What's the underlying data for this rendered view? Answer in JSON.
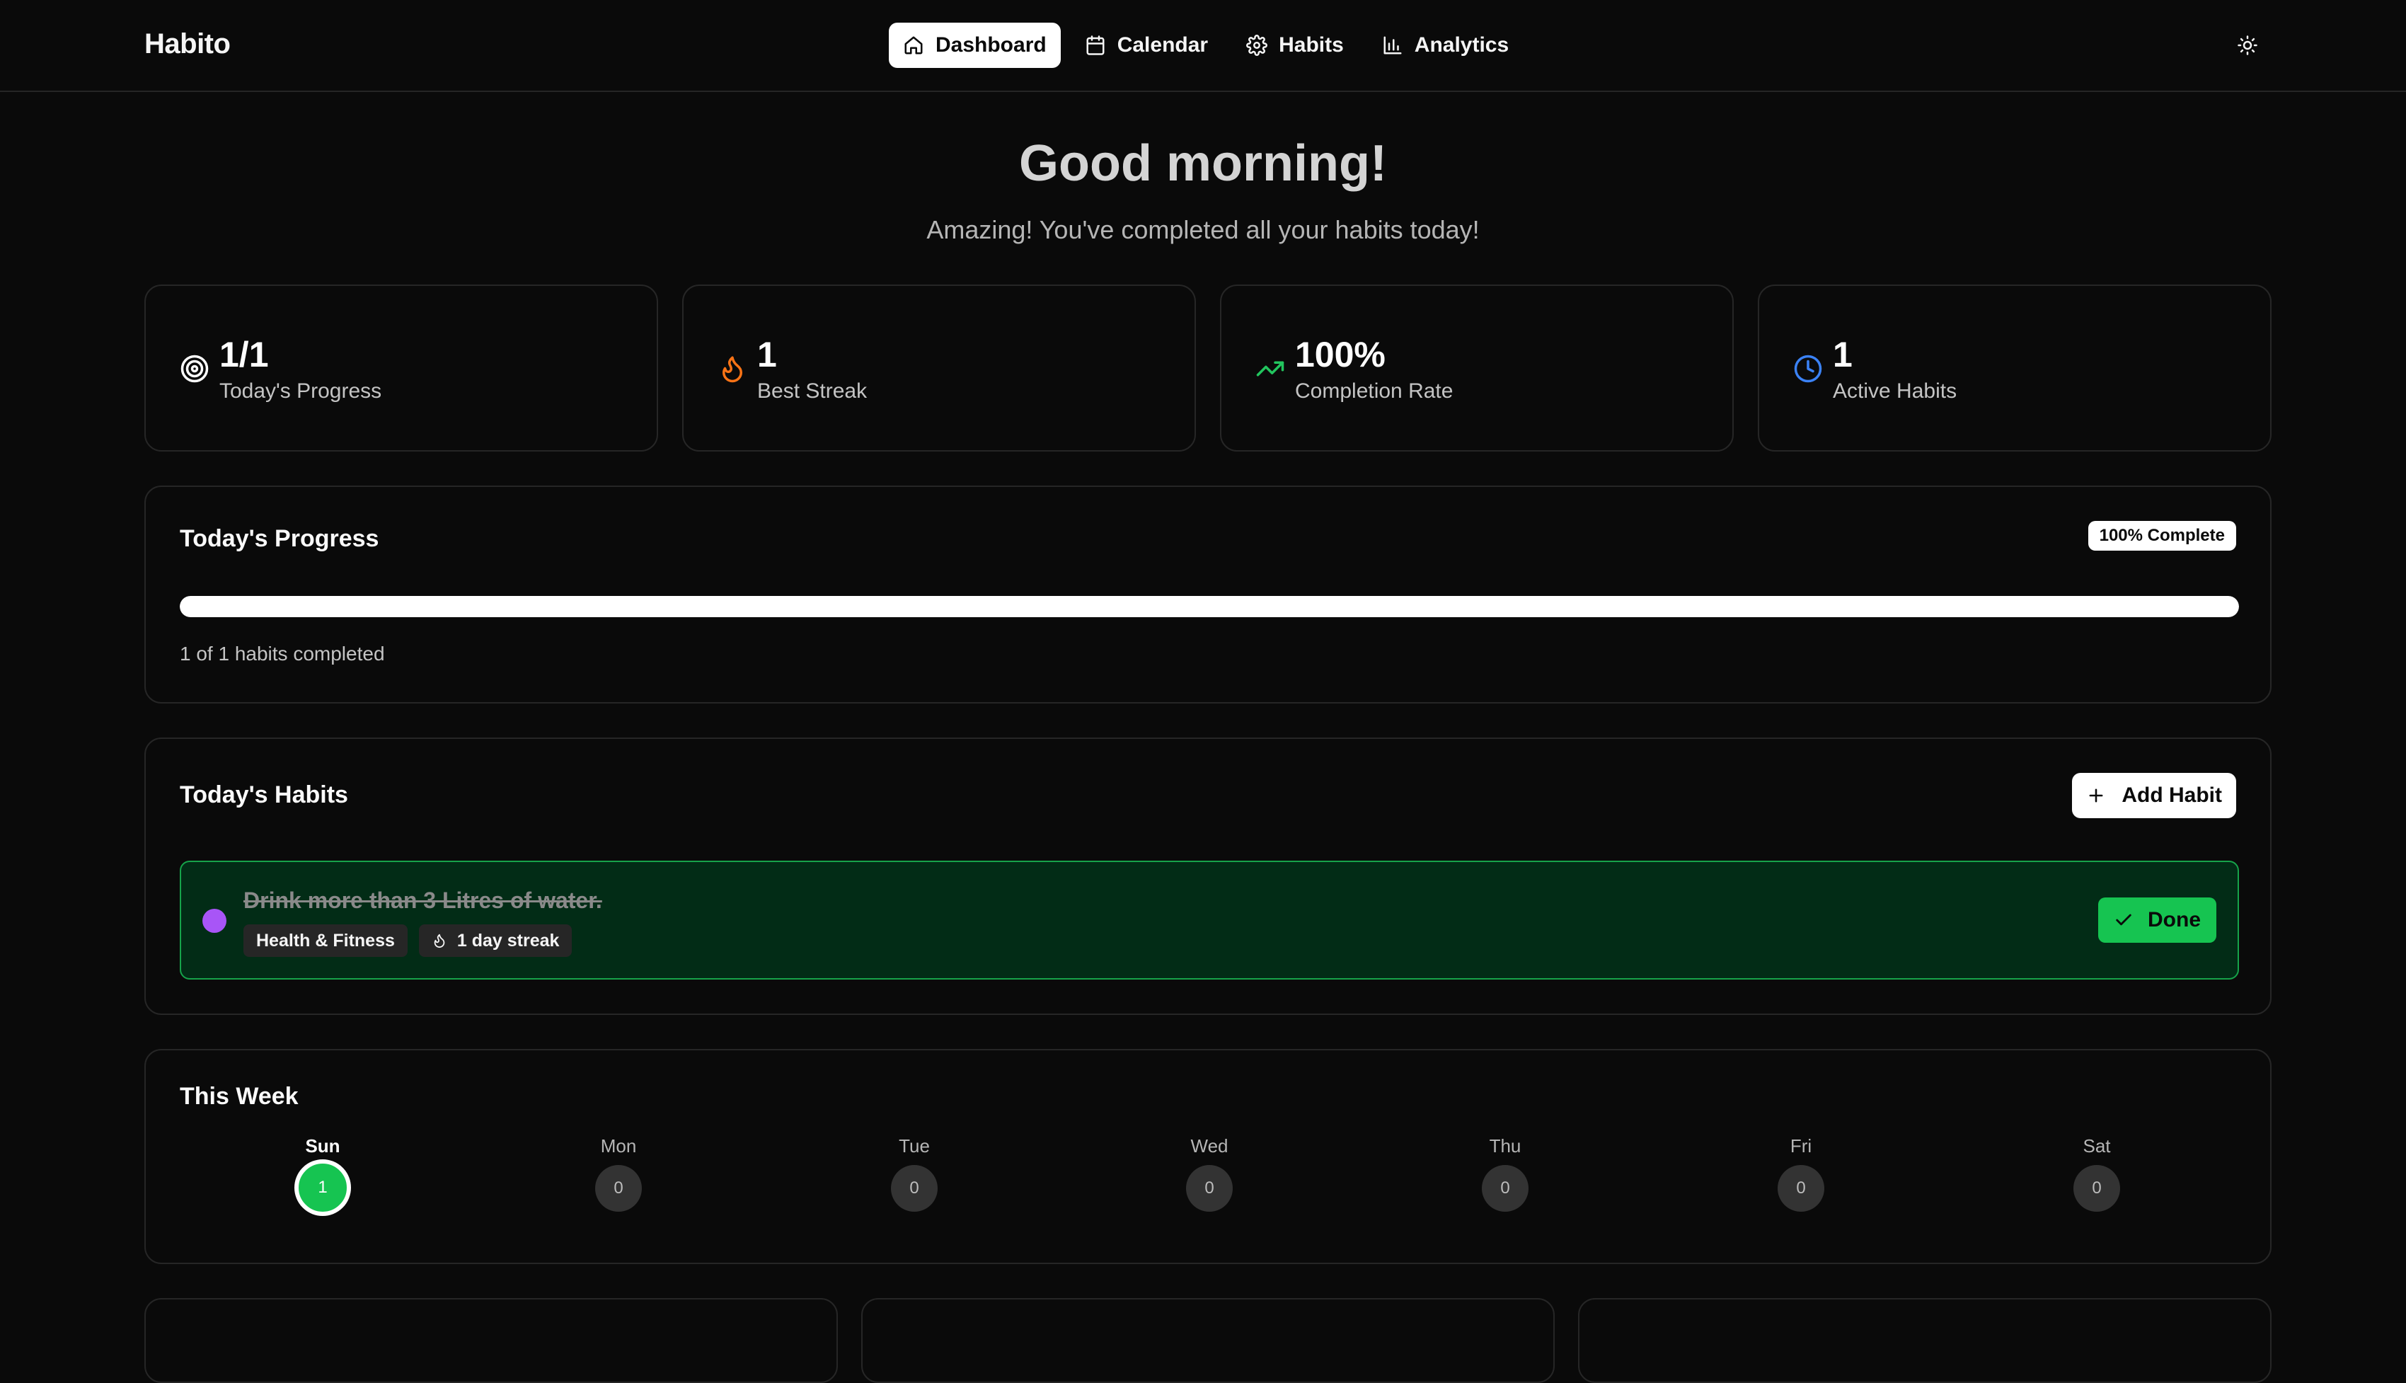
{
  "app": {
    "title": "Habito"
  },
  "nav": {
    "items": [
      {
        "label": "Dashboard",
        "icon": "home-icon",
        "active": true
      },
      {
        "label": "Calendar",
        "icon": "calendar-icon",
        "active": false
      },
      {
        "label": "Habits",
        "icon": "gear-icon",
        "active": false
      },
      {
        "label": "Analytics",
        "icon": "bar-chart-icon",
        "active": false
      }
    ],
    "theme_toggle_icon": "sun-icon"
  },
  "greeting": {
    "title": "Good morning!",
    "subtitle": "Amazing! You've completed all your habits today!"
  },
  "stats": [
    {
      "value": "1/1",
      "label": "Today's Progress",
      "icon": "target-icon",
      "color": "#ffffff"
    },
    {
      "value": "1",
      "label": "Best Streak",
      "icon": "flame-icon",
      "color": "#f97316"
    },
    {
      "value": "100%",
      "label": "Completion Rate",
      "icon": "trending-up-icon",
      "color": "#22c55e"
    },
    {
      "value": "1",
      "label": "Active Habits",
      "icon": "clock-icon",
      "color": "#3b82f6"
    }
  ],
  "progress": {
    "title": "Today's Progress",
    "badge": "100% Complete",
    "fraction": 1.0,
    "summary": "1 of 1 habits completed"
  },
  "habits": {
    "title": "Today's Habits",
    "add_label": "Add Habit",
    "items": [
      {
        "name": "Drink more than 3 Litres of water.",
        "category": "Health & Fitness",
        "streak": "1 day streak",
        "dot_color": "#a855f7",
        "status_label": "Done",
        "completed": true
      }
    ]
  },
  "week": {
    "title": "This Week",
    "days": [
      {
        "name": "Sun",
        "count": "1",
        "today": true
      },
      {
        "name": "Mon",
        "count": "0",
        "today": false
      },
      {
        "name": "Tue",
        "count": "0",
        "today": false
      },
      {
        "name": "Wed",
        "count": "0",
        "today": false
      },
      {
        "name": "Thu",
        "count": "0",
        "today": false
      },
      {
        "name": "Fri",
        "count": "0",
        "today": false
      },
      {
        "name": "Sat",
        "count": "0",
        "today": false
      }
    ]
  },
  "colors": {
    "background": "#0a0a0a",
    "border": "#262626",
    "success": "#16c451",
    "habit_bg": "#022c16"
  }
}
